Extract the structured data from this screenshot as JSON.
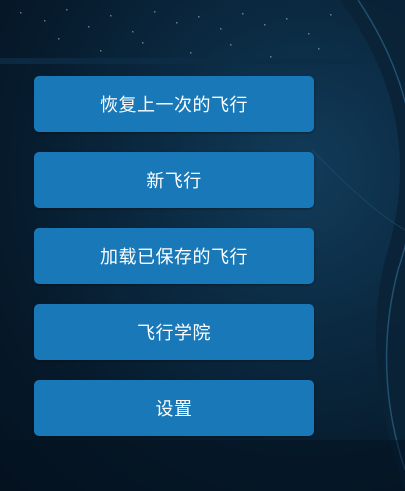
{
  "menu": {
    "items": [
      {
        "label": "恢复上一次的飞行"
      },
      {
        "label": "新飞行"
      },
      {
        "label": "加载已保存的飞行"
      },
      {
        "label": "飞行学院"
      },
      {
        "label": "设置"
      }
    ]
  },
  "theme": {
    "button_color": "#1878b8",
    "text_color": "#ffffff"
  }
}
